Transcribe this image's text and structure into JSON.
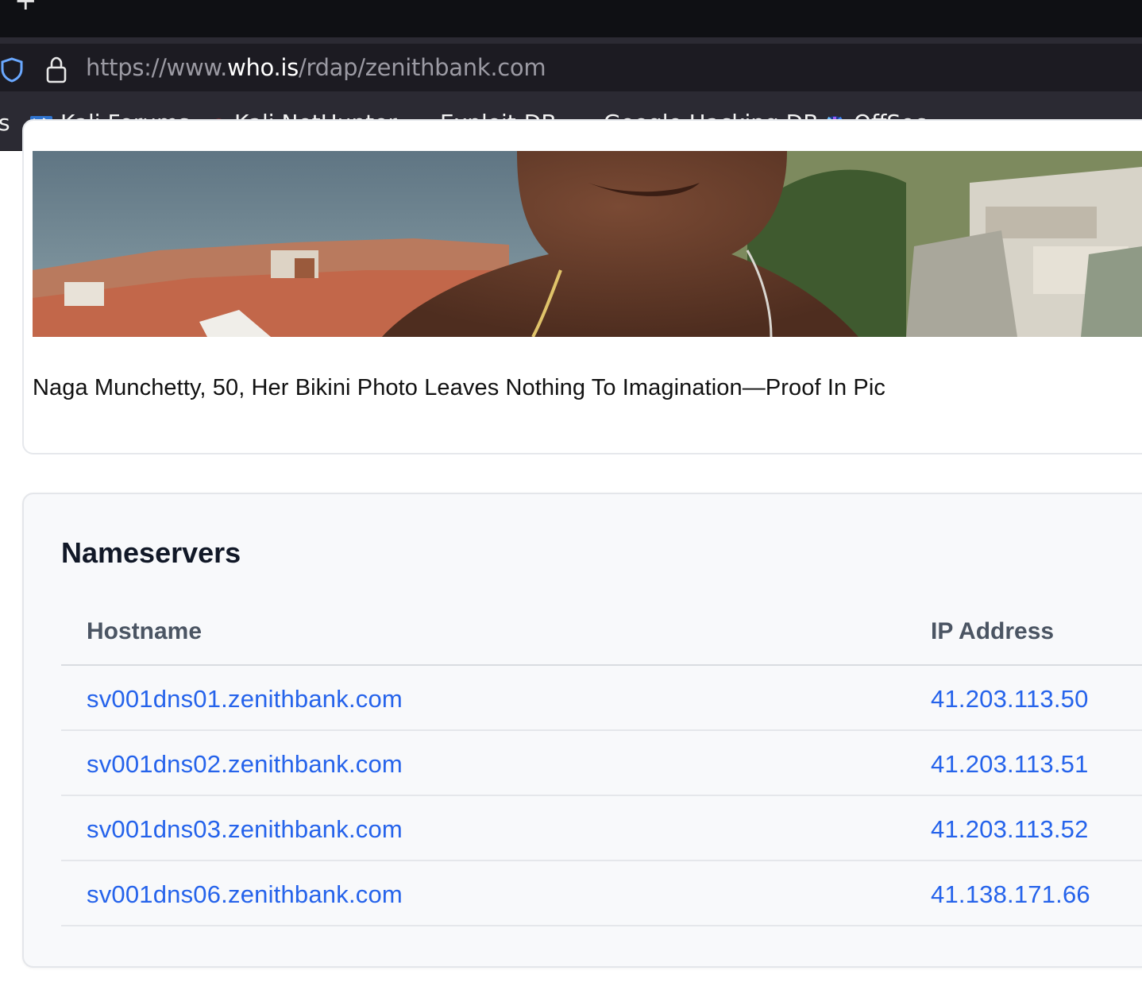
{
  "browser": {
    "new_tab_glyph": "+",
    "url": {
      "scheme": "https://www.",
      "host": "who.is",
      "path": "/rdap/zenithbank.com"
    },
    "bookmarks": [
      {
        "label": "s",
        "icon": "truncated"
      },
      {
        "label": "Kali Forums",
        "icon": "kali-forums-icon"
      },
      {
        "label": "Kali NetHunter",
        "icon": "kali-nethunter-icon"
      },
      {
        "label": "Exploit-DB",
        "icon": "exploit-db-icon"
      },
      {
        "label": "Google Hacking DB",
        "icon": "ghdb-icon"
      },
      {
        "label": "OffSec",
        "icon": "offsec-icon"
      }
    ]
  },
  "ad": {
    "caption": "Naga Munchetty, 50, Her Bikini Photo Leaves Nothing To Imagination—Proof In Pic"
  },
  "nameservers": {
    "title": "Nameservers",
    "columns": [
      "Hostname",
      "IP Address"
    ],
    "rows": [
      {
        "hostname": "sv001dns01.zenithbank.com",
        "ip": "41.203.113.50"
      },
      {
        "hostname": "sv001dns02.zenithbank.com",
        "ip": "41.203.113.51"
      },
      {
        "hostname": "sv001dns03.zenithbank.com",
        "ip": "41.203.113.52"
      },
      {
        "hostname": "sv001dns06.zenithbank.com",
        "ip": "41.138.171.66"
      }
    ]
  },
  "colors": {
    "link": "#2563eb",
    "chrome_dark": "#0f1014",
    "toolbar": "#2b2a33"
  }
}
